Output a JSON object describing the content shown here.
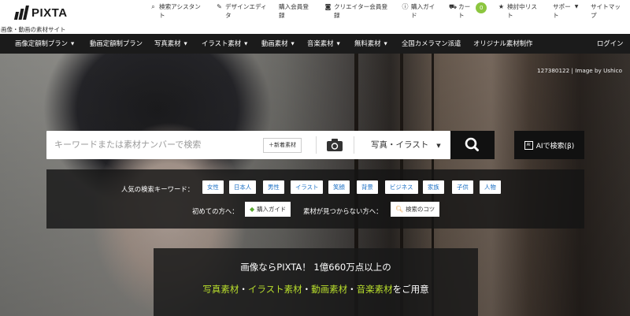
{
  "header": {
    "logo_text": "PIXTA",
    "tagline": "画像・動画の素材サイト",
    "links": [
      {
        "icon": "search-icon",
        "glyph": "🔍",
        "label": "検索アシスタン\nト"
      },
      {
        "icon": "pen-icon",
        "glyph": "✎",
        "label": "デザインエディ\nタ"
      },
      {
        "icon": "",
        "glyph": "",
        "label": "購入会員登\n録"
      },
      {
        "icon": "camera-icon",
        "glyph": "📷",
        "label": "クリエイター会員登\n録"
      },
      {
        "icon": "info-icon",
        "glyph": "ⓘ",
        "label": "購入ガイ\nド"
      },
      {
        "icon": "cart-icon",
        "glyph": "🛒",
        "label": "カー\nト"
      },
      {
        "icon": "star-icon",
        "glyph": "★",
        "label": "検討中リス\nト"
      },
      {
        "icon": "",
        "glyph": "",
        "label": "サポー\nト"
      },
      {
        "icon": "",
        "glyph": "",
        "label": "サイトマッ\nプ"
      }
    ],
    "cart_count": "0"
  },
  "nav": {
    "items": [
      {
        "label": "画像定額制プラン",
        "dropdown": true
      },
      {
        "label": "動画定額制プラン",
        "dropdown": false
      },
      {
        "label": "写真素材",
        "dropdown": true
      },
      {
        "label": "イラスト素材",
        "dropdown": true
      },
      {
        "label": "動画素材",
        "dropdown": true
      },
      {
        "label": "音楽素材",
        "dropdown": true
      },
      {
        "label": "無料素材",
        "dropdown": true
      },
      {
        "label": "全国カメラマン派遣",
        "dropdown": false
      },
      {
        "label": "オリジナル素材制作",
        "dropdown": false
      }
    ],
    "login": "ログイン"
  },
  "hero": {
    "credit": "127380122 | Image by Ushico"
  },
  "search": {
    "placeholder": "キーワードまたは素材ナンバーで検索",
    "new_button": "＋新着素材",
    "type_select": "写真・イラスト",
    "ai_button": "AIで検索(β)"
  },
  "keywords": {
    "label": "人気の検索キーワード：",
    "chips": [
      "女性",
      "日本人",
      "男性",
      "イラスト",
      "笑顔",
      "背景",
      "ビジネス",
      "家族",
      "子供",
      "人物"
    ],
    "first_time_label": "初めての方へ：",
    "guide_button": "購入ガイド",
    "not_found_label": "素材が見つからない方へ：",
    "tips_button": "検索のコツ"
  },
  "promo": {
    "line1": "画像ならPIXTA！ 1億660万点以上の",
    "line2_parts": [
      {
        "text": "写真素材",
        "accent": true
      },
      {
        "text": "・",
        "accent": false
      },
      {
        "text": "イラスト素材",
        "accent": true
      },
      {
        "text": "・",
        "accent": false
      },
      {
        "text": "動画素材",
        "accent": true
      },
      {
        "text": "・",
        "accent": false
      },
      {
        "text": "音楽素材",
        "accent": true
      },
      {
        "text": "をご用意",
        "accent": false
      }
    ]
  },
  "colors": {
    "accent_green": "#b7dc2c",
    "chip_text": "#1a6fc4",
    "cart_badge": "#8cc63f"
  }
}
